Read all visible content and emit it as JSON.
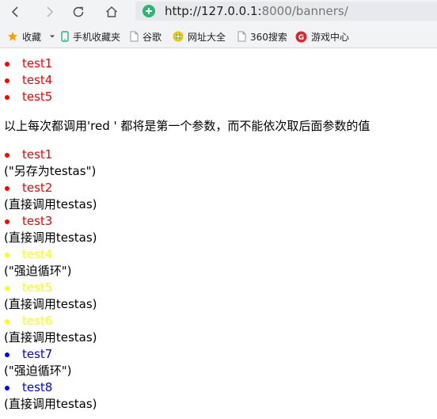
{
  "browser": {
    "url_host": "http://127.0.0.1:",
    "url_rest": "8000/banners/",
    "bookmarks": [
      {
        "label": "收藏",
        "icon": "star-icon"
      },
      {
        "label": "手机收藏夹",
        "icon": "phone-icon"
      },
      {
        "label": "谷歌",
        "icon": "page-icon"
      },
      {
        "label": "网址大全",
        "icon": "globe-icon"
      },
      {
        "label": "360搜索",
        "icon": "page-icon"
      },
      {
        "label": "游戏中心",
        "icon": "game-icon"
      }
    ]
  },
  "colors": {
    "red": "#ff0000",
    "yellow": "#ffff00",
    "blue": "#0000ff"
  },
  "first_list": [
    {
      "label": "test1",
      "color": "#ff0000"
    },
    {
      "label": "test4",
      "color": "#ff0000"
    },
    {
      "label": "test5",
      "color": "#ff0000"
    }
  ],
  "explanation": "以上每次都调用'red ' 都将是第一个参数，而不能依次取后面参数的值",
  "second_list": [
    {
      "label": "test1",
      "color": "#ff0000",
      "note": "(\"另存为testas\")"
    },
    {
      "label": "test2",
      "color": "#ff0000",
      "note": "(直接调用testas)"
    },
    {
      "label": "test3",
      "color": "#ff0000",
      "note": "(直接调用testas)"
    },
    {
      "label": "test4",
      "color": "#ffff00",
      "note": "(\"强迫循环\")"
    },
    {
      "label": "test5",
      "color": "#ffff00",
      "note": "(直接调用testas)"
    },
    {
      "label": "test6",
      "color": "#ffff00",
      "note": "(直接调用testas)"
    },
    {
      "label": "test7",
      "color": "#0000ff",
      "note": "(\"强迫循环\")"
    },
    {
      "label": "test8",
      "color": "#0000ff",
      "note": "(直接调用testas)"
    }
  ]
}
